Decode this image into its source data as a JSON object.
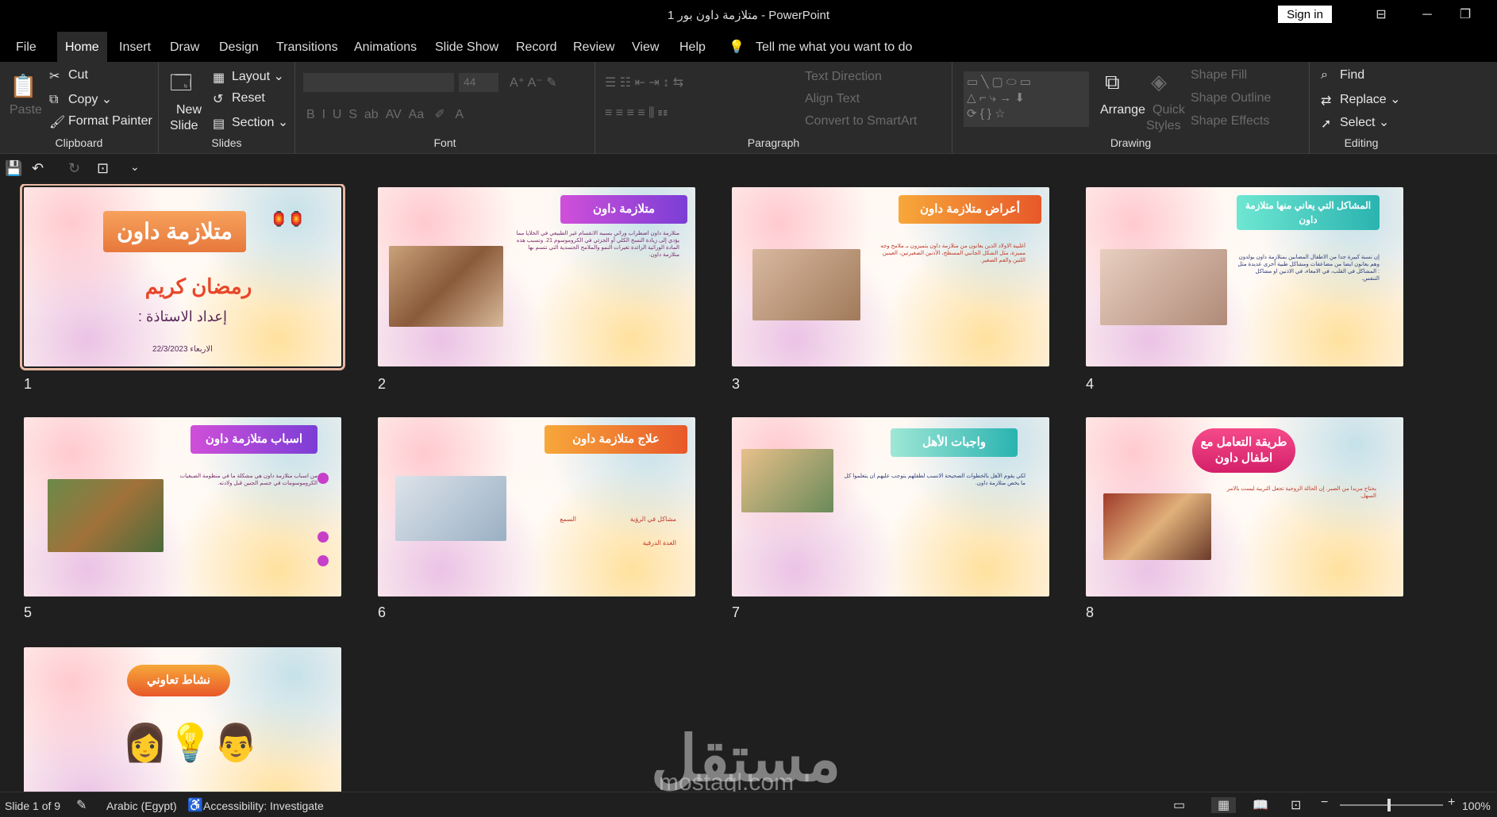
{
  "window": {
    "title": "متلازمة داون بور 1  -  PowerPoint",
    "signin": "Sign in"
  },
  "tabs": [
    "File",
    "Home",
    "Insert",
    "Draw",
    "Design",
    "Transitions",
    "Animations",
    "Slide Show",
    "Record",
    "Review",
    "View",
    "Help"
  ],
  "tellme": "Tell me what you want to do",
  "ribbon": {
    "clipboard": {
      "paste": "Paste",
      "cut": "Cut",
      "copy": "Copy",
      "format_painter": "Format Painter",
      "label": "Clipboard"
    },
    "slides": {
      "new_slide": "New",
      "new_slide2": "Slide",
      "layout": "Layout",
      "reset": "Reset",
      "section": "Section",
      "label": "Slides"
    },
    "font": {
      "size": "44",
      "label": "Font"
    },
    "paragraph": {
      "text_direction": "Text Direction",
      "align_text": "Align Text",
      "smartart": "Convert to SmartArt",
      "label": "Paragraph"
    },
    "drawing": {
      "arrange": "Arrange",
      "quick": "Quick",
      "styles": "Styles",
      "shape_fill": "Shape Fill",
      "shape_outline": "Shape Outline",
      "shape_effects": "Shape Effects",
      "label": "Drawing"
    },
    "editing": {
      "find": "Find",
      "replace": "Replace",
      "select": "Select",
      "label": "Editing"
    }
  },
  "slides": [
    {
      "num": "1",
      "title": "متلازمة داون",
      "subtitle": "رمضان كريم",
      "author": "إعداد الاستاذة :",
      "date": "الاربعاء 22/3/2023"
    },
    {
      "num": "2",
      "title": "متلازمة داون",
      "body": "متلازمة داون اضطراب وراثي يسببه الانقسام غير الطبيعي في الخلايا مما يؤدي إلى زيادة النسخ الكلي أو الجزئي في الكروموسوم 21. وتسبب هذه المادة الوراثية الزائدة تغيرات النمو والملامح الجسدية التي تتسم بها متلازمة داون."
    },
    {
      "num": "3",
      "title": "أعراض متلازمة داون",
      "body": "أغلبية الاولاد الذين يعانون من متلازمة داون يتميزون بـ ملامح وجه مميزة، مثل الشكل الجانبي المسطح، الأذنين الصغيرتين، العينين اللتين والفم الصغير."
    },
    {
      "num": "4",
      "title": "المشاكل التي يعاني منها متلازمة داون",
      "body": "إن نسبة كبيرة جدا من الاطفال المصابين بمتلازمة داون يولدون وهم يعانون ايضا من مضاعفات ومشاكل طبية أخرى عديدة مثل : المشاكل في القلب، في الامعاء، في الاذنين او مشاكل التنفس."
    },
    {
      "num": "5",
      "title": "اسباب متلازمة داون",
      "body": "من اسباب متلازمة داون هي مشكلة ما في منظومة الصبغيات الكروموسومات في جسم الجنين قبل ولادته."
    },
    {
      "num": "6",
      "title": "علاج متلازمة داون",
      "items": [
        "مشاكل في الرؤية",
        "السمع",
        "الغدة الدرقية"
      ]
    },
    {
      "num": "7",
      "title": "واجبات الأهل",
      "body": "لكي يقوم الأهل بالخطوات الصحيحة الانسب لطفلهم يتوجب عليهم ان يتعلموا كل ما يخص متلازمة داون."
    },
    {
      "num": "8",
      "title": "طريقة التعامل مع اطفال داون",
      "body": "يحتاج مزيدا من الصبر. إن الحالة الزوجية تجعل التربية ليست بالامر السهل."
    },
    {
      "num": "9",
      "title": "نشاط تعاوني"
    }
  ],
  "status": {
    "slide": "Slide 1 of 9",
    "language": "Arabic (Egypt)",
    "accessibility": "Accessibility: Investigate",
    "zoom": "100%"
  },
  "watermark": {
    "ar": "مستقل",
    "en": "mostaql.com"
  }
}
